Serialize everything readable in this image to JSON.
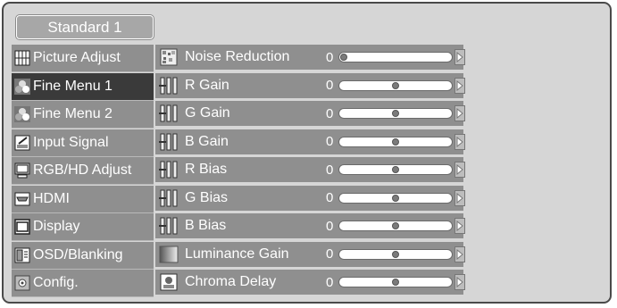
{
  "mode": {
    "label": "Standard 1"
  },
  "sidebar": {
    "items": [
      {
        "label": "Picture Adjust",
        "icon": "grid-icon",
        "selected": false
      },
      {
        "label": "Fine Menu 1",
        "icon": "color-circles-icon",
        "selected": true
      },
      {
        "label": "Fine Menu 2",
        "icon": "color-circles-icon",
        "selected": false
      },
      {
        "label": "Input Signal",
        "icon": "document-pencil-icon",
        "selected": false
      },
      {
        "label": "RGB/HD Adjust",
        "icon": "monitor-icon",
        "selected": false
      },
      {
        "label": "HDMI",
        "icon": "hdmi-port-icon",
        "selected": false
      },
      {
        "label": "Display",
        "icon": "screen-frame-icon",
        "selected": false
      },
      {
        "label": "OSD/Blanking",
        "icon": "osd-panel-icon",
        "selected": false
      },
      {
        "label": "Config.",
        "icon": "config-gear-icon",
        "selected": false
      }
    ]
  },
  "settings": {
    "rows": [
      {
        "label": "Noise Reduction",
        "icon": "noise-icon",
        "value": "0",
        "level": 0.0
      },
      {
        "label": "R Gain",
        "icon": "level-bars-icon",
        "value": "0",
        "level": 0.5
      },
      {
        "label": "G Gain",
        "icon": "level-bars-icon",
        "value": "0",
        "level": 0.5
      },
      {
        "label": "B Gain",
        "icon": "level-bars-icon",
        "value": "0",
        "level": 0.5
      },
      {
        "label": "R Bias",
        "icon": "level-bars-icon",
        "value": "0",
        "level": 0.5
      },
      {
        "label": "G Bias",
        "icon": "level-bars-icon",
        "value": "0",
        "level": 0.5
      },
      {
        "label": "B Bias",
        "icon": "level-bars-icon",
        "value": "0",
        "level": 0.5
      },
      {
        "label": "Luminance Gain",
        "icon": "luminance-icon",
        "value": "0",
        "level": 0.5
      },
      {
        "label": "Chroma Delay",
        "icon": "chroma-icon",
        "value": "0",
        "level": 0.5
      }
    ]
  },
  "colors": {
    "panel": "#d6d6d6",
    "item": "#8f8f8f",
    "selected": "#3a3a3a",
    "text": "#ffffff"
  }
}
